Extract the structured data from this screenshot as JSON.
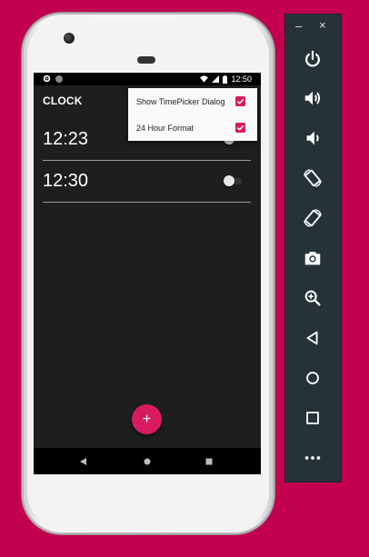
{
  "statusbar": {
    "time": "12:50"
  },
  "app": {
    "title": "CLOCK"
  },
  "alarms": [
    {
      "time": "12:23"
    },
    {
      "time": "12:30"
    }
  ],
  "menu": {
    "items": [
      {
        "label": "Show TimePicker Dialog",
        "checked": true
      },
      {
        "label": "24 Hour Format",
        "checked": true
      }
    ]
  },
  "fab": {
    "label": "+"
  },
  "emulator": {
    "minimize": "–",
    "close": "×",
    "buttons": [
      "power-icon",
      "volume-up-icon",
      "volume-down-icon",
      "rotate-left-icon",
      "rotate-right-icon",
      "camera-icon",
      "zoom-icon",
      "back-icon",
      "home-icon",
      "overview-icon",
      "more-icon"
    ]
  },
  "colors": {
    "accent": "#d81b60",
    "background": "#c2004f",
    "toolbar": "#263238"
  }
}
